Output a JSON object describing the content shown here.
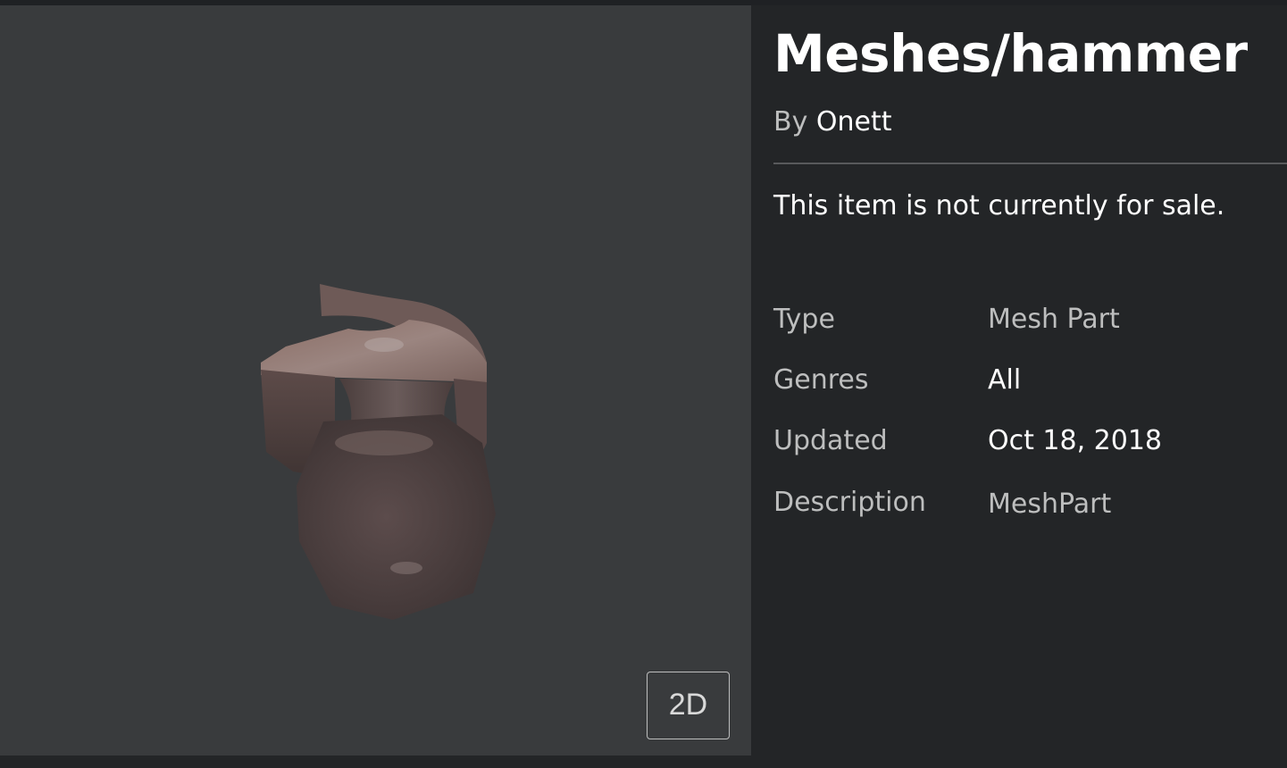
{
  "item": {
    "title": "Meshes/hammer",
    "by_prefix": "By",
    "creator": "Onett",
    "sale_status": "This item is not currently for sale."
  },
  "viewer": {
    "toggle_label": "2D",
    "model_icon": "hammer-3d-model"
  },
  "details": [
    {
      "label": "Type",
      "value": "Mesh Part"
    },
    {
      "label": "Genres",
      "value": "All"
    },
    {
      "label": "Updated",
      "value": "Oct 18, 2018"
    },
    {
      "label": "Description",
      "value": "MeshPart"
    }
  ],
  "colors": {
    "page_background": "#232527",
    "viewer_background": "#393b3d",
    "primary_text": "#ffffff",
    "secondary_text": "#bdbebe"
  }
}
